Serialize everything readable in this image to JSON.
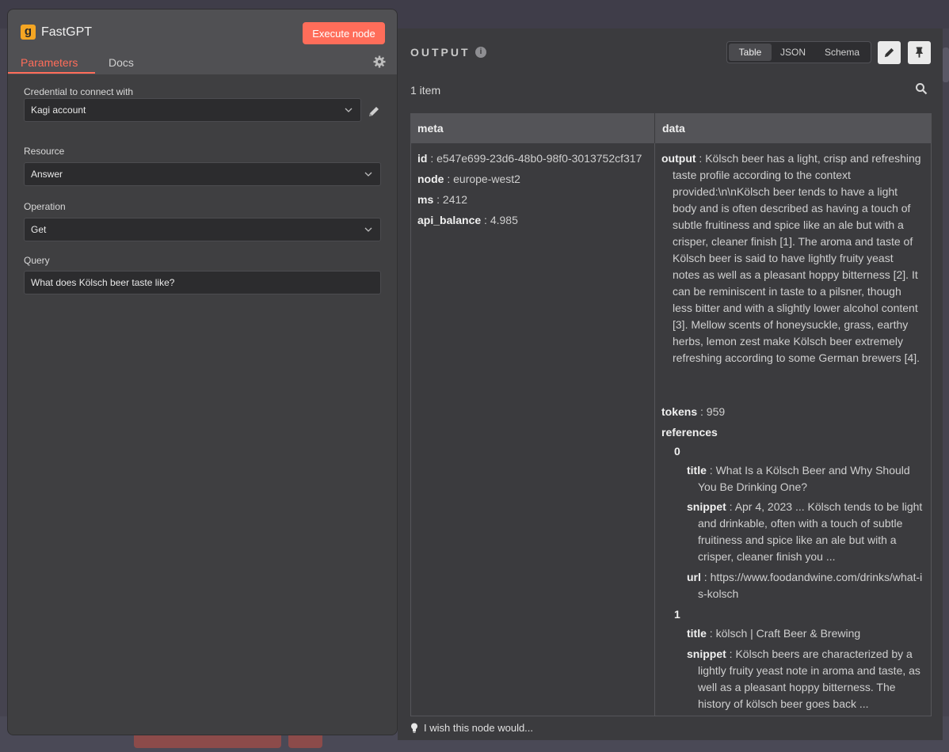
{
  "node": {
    "logo_letter": "g",
    "title": "FastGPT",
    "execute_label": "Execute node",
    "tabs": [
      "Parameters",
      "Docs"
    ]
  },
  "params": {
    "credential_label": "Credential to connect with",
    "credential_value": "Kagi account",
    "resource_label": "Resource",
    "resource_value": "Answer",
    "operation_label": "Operation",
    "operation_value": "Get",
    "query_label": "Query",
    "query_value": "What does Kölsch beer taste like?"
  },
  "output": {
    "title": "OUTPUT",
    "views": [
      "Table",
      "JSON",
      "Schema"
    ],
    "active_view": "Table",
    "item_count": "1 item",
    "columns": [
      "meta",
      "data"
    ],
    "meta": [
      {
        "key": "id",
        "value": "e547e699-23d6-48b0-98f0-3013752cf317"
      },
      {
        "key": "node",
        "value": "europe-west2"
      },
      {
        "key": "ms",
        "value": "2412"
      },
      {
        "key": "api_balance",
        "value": "4.985"
      }
    ],
    "data": {
      "output_key": "output",
      "output_value": "Kölsch beer has a light, crisp and refreshing taste profile according to the context provided:\\n\\nKölsch beer tends to have a light body and is often described as having a touch of subtle fruitiness and spice like an ale but with a crisper, cleaner finish [1]. The aroma and taste of Kölsch beer is said to have lightly fruity yeast notes as well as a pleasant hoppy bitterness [2]. It can be reminiscent in taste to a pilsner, though less bitter and with a slightly lower alcohol content [3]. Mellow scents of honeysuckle, grass, earthy herbs, lemon zest make Kölsch beer extremely refreshing according to some German brewers [4].",
      "tokens_key": "tokens",
      "tokens_value": "959",
      "references_key": "references",
      "references": [
        {
          "index": "0",
          "title": "What Is a Kölsch Beer and Why Should You Be Drinking One?",
          "snippet": "Apr 4, 2023 ... Kölsch tends to be light and drinkable, often with a touch of subtle fruitiness and spice like an ale but with a crisper, cleaner finish you ...",
          "url": "https://www.foodandwine.com/drinks/what-is-kolsch"
        },
        {
          "index": "1",
          "title": "kölsch | Craft Beer & Brewing",
          "snippet": "Kölsch beers are characterized by a lightly fruity yeast note in aroma and taste, as well as a pleasant hoppy bitterness. The history of kölsch beer goes back ..."
        }
      ]
    }
  },
  "footer": {
    "tip": "I wish this node would..."
  }
}
